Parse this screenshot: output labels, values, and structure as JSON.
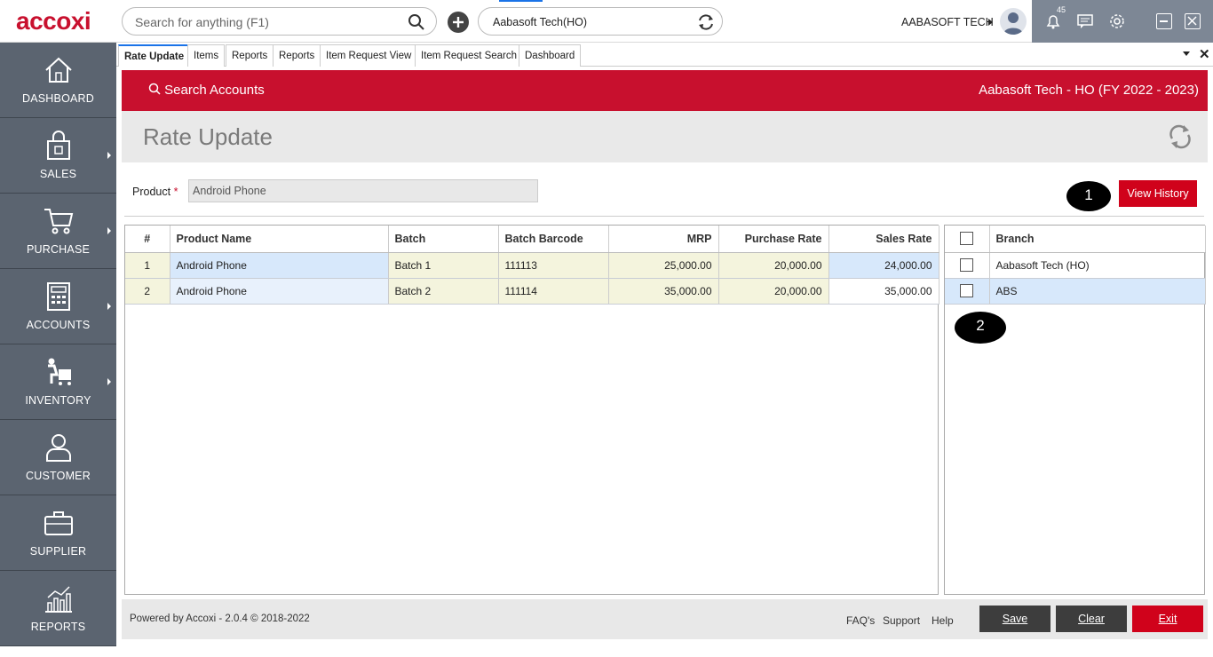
{
  "app": {
    "logo": "accoxi"
  },
  "search": {
    "placeholder": "Search for anything (F1)"
  },
  "branch_selector": {
    "value": "Aabasoft Tech(HO)"
  },
  "user": {
    "name": "AABASOFT TECH",
    "notification_count": "45"
  },
  "sidebar": {
    "items": [
      {
        "label": "DASHBOARD",
        "icon": "home-icon"
      },
      {
        "label": "SALES",
        "icon": "shopping-bag-icon"
      },
      {
        "label": "PURCHASE",
        "icon": "cart-icon"
      },
      {
        "label": "ACCOUNTS",
        "icon": "calculator-icon"
      },
      {
        "label": "INVENTORY",
        "icon": "inventory-icon"
      },
      {
        "label": "CUSTOMER",
        "icon": "person-icon"
      },
      {
        "label": "SUPPLIER",
        "icon": "briefcase-icon"
      },
      {
        "label": "REPORTS",
        "icon": "bar-chart-icon"
      }
    ]
  },
  "tabs": [
    "Rate Update",
    "Items",
    "Reports",
    "Reports",
    "Item Request View",
    "Item Request Search",
    "Dashboard"
  ],
  "header": {
    "search_accounts": "Search Accounts",
    "company": "Aabasoft Tech - HO (FY 2022 - 2023)"
  },
  "page": {
    "title": "Rate Update"
  },
  "form": {
    "product_label": "Product",
    "required_mark": "*",
    "product_value": "Android Phone",
    "view_history": "View History"
  },
  "badges": {
    "one": "1",
    "two": "2"
  },
  "rate_table": {
    "headers": [
      "#",
      "Product Name",
      "Batch",
      "Batch Barcode",
      "MRP",
      "Purchase Rate",
      "Sales Rate"
    ],
    "rows": [
      [
        "1",
        "Android Phone",
        "Batch 1",
        "111113",
        "25,000.00",
        "20,000.00",
        "24,000.00"
      ],
      [
        "2",
        "Android Phone",
        "Batch 2",
        "111114",
        "35,000.00",
        "20,000.00",
        "35,000.00"
      ]
    ]
  },
  "branch_table": {
    "header": "Branch",
    "rows": [
      "Aabasoft Tech (HO)",
      "ABS"
    ]
  },
  "footer": {
    "powered": "Powered by Accoxi - 2.0.4 © 2018-2022",
    "links": [
      "FAQ's",
      "Support",
      "Help"
    ],
    "save": "Save",
    "clear": "Clear",
    "exit": "Exit"
  },
  "colors": {
    "brand_red": "#c8102e",
    "sidebar": "#5b6470",
    "topright": "#7d8795",
    "button_dark": "#3d3d3d"
  }
}
